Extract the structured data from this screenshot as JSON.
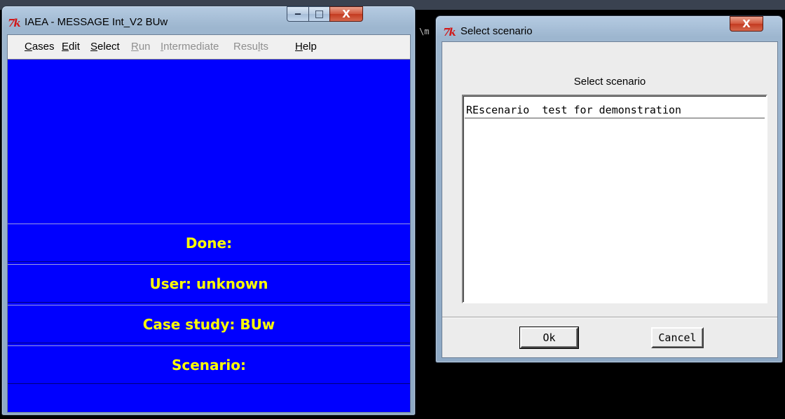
{
  "main_window": {
    "title": "IAEA - MESSAGE Int_V2 BUw",
    "app_icon": "tk-feather-icon",
    "controls": {
      "minimize": "‒",
      "maximize": "□",
      "close": "X"
    },
    "menu": [
      {
        "label": "Cases",
        "mnemonic_index": 0,
        "enabled": true
      },
      {
        "label": "Edit",
        "mnemonic_index": 0,
        "enabled": true
      },
      {
        "label": "Select",
        "mnemonic_index": 0,
        "enabled": true
      },
      {
        "label": "Run",
        "mnemonic_index": 0,
        "enabled": false
      },
      {
        "label": "Intermediate",
        "mnemonic_index": 0,
        "enabled": false
      },
      {
        "label": "Results",
        "mnemonic_index": 4,
        "enabled": false
      },
      {
        "label": "Help",
        "mnemonic_index": 0,
        "enabled": true
      }
    ],
    "status": {
      "done": "Done:",
      "user": "User: unknown",
      "case_study": "Case study: BUw",
      "scenario": "Scenario:"
    },
    "colors": {
      "background": "#0000ff",
      "status_text": "#ffff00"
    }
  },
  "dialog": {
    "title": "Select scenario",
    "heading": "Select scenario",
    "items": [
      "REscenario  test for demonstration"
    ],
    "ok_label": "Ok",
    "cancel_label": "Cancel",
    "close": "X"
  }
}
